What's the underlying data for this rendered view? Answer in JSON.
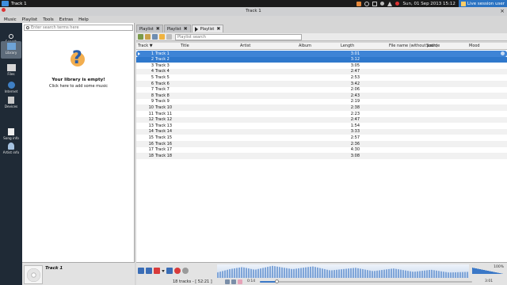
{
  "top_panel": {
    "window_title": "Track 1",
    "clock": "Sun, 01 Sep 2013 15:12",
    "session": "Live session user",
    "tray_icons": [
      "battery-icon",
      "network-icon",
      "volume-icon",
      "dropbox-icon",
      "bluetooth-icon",
      "mail-icon"
    ]
  },
  "window": {
    "title": "Track 1",
    "close_glyph": "×"
  },
  "menu": [
    "Music",
    "Playlist",
    "Tools",
    "Extras",
    "Help"
  ],
  "sidebar": {
    "items": [
      {
        "label": "Search",
        "icon": "search-icon"
      },
      {
        "label": "Library",
        "icon": "library-icon",
        "active": true
      },
      {
        "label": "Files",
        "icon": "files-icon"
      },
      {
        "label": "Internet",
        "icon": "internet-icon"
      },
      {
        "label": "Devices",
        "icon": "devices-icon"
      },
      {
        "label": "Song info",
        "icon": "song-info-icon"
      },
      {
        "label": "Artist info",
        "icon": "artist-info-icon"
      }
    ]
  },
  "library": {
    "search_placeholder": "Enter search terms here",
    "empty_title": "Your library is empty!",
    "empty_hint": "Click here to add some music"
  },
  "tabs": [
    {
      "label": "Playlist",
      "close": "✖"
    },
    {
      "label": "Playlist",
      "close": "✖"
    },
    {
      "label": "Playlist",
      "close": "✖",
      "active": true
    }
  ],
  "playlist": {
    "search_placeholder": "Playlist search",
    "columns": [
      "Track",
      "Title",
      "Artist",
      "Album",
      "Length",
      "File name (without path)",
      "Source",
      "Mood"
    ],
    "sort_indicator": "▼",
    "rows": [
      {
        "num": "1",
        "title": "Track 1",
        "length": "3:01"
      },
      {
        "num": "2",
        "title": "Track 2",
        "length": "3:12"
      },
      {
        "num": "3",
        "title": "Track 3",
        "length": "3:05"
      },
      {
        "num": "4",
        "title": "Track 4",
        "length": "2:47"
      },
      {
        "num": "5",
        "title": "Track 5",
        "length": "2:53"
      },
      {
        "num": "6",
        "title": "Track 6",
        "length": "3:42"
      },
      {
        "num": "7",
        "title": "Track 7",
        "length": "2:06"
      },
      {
        "num": "8",
        "title": "Track 8",
        "length": "2:43"
      },
      {
        "num": "9",
        "title": "Track 9",
        "length": "2:19"
      },
      {
        "num": "10",
        "title": "Track 10",
        "length": "2:38"
      },
      {
        "num": "11",
        "title": "Track 11",
        "length": "2:23"
      },
      {
        "num": "12",
        "title": "Track 12",
        "length": "2:47"
      },
      {
        "num": "13",
        "title": "Track 13",
        "length": "1:54"
      },
      {
        "num": "14",
        "title": "Track 14",
        "length": "3:33"
      },
      {
        "num": "15",
        "title": "Track 15",
        "length": "2:57"
      },
      {
        "num": "16",
        "title": "Track 16",
        "length": "2:36"
      },
      {
        "num": "17",
        "title": "Track 17",
        "length": "4:30"
      },
      {
        "num": "18",
        "title": "Track 18",
        "length": "3:08"
      }
    ],
    "playing_row": 0,
    "selected_row": 1
  },
  "now_playing": {
    "track": "Track 1"
  },
  "player": {
    "status": "18 tracks - [ 52:21 ]",
    "time_current": "0:14",
    "time_total": "3:01",
    "progress": 0.08,
    "volume_label": "100%",
    "volume": 1.0
  },
  "colors": {
    "selection": "#2f78cc",
    "sidebar_bg": "#1f2a36",
    "stop_red": "#d83b3b"
  }
}
